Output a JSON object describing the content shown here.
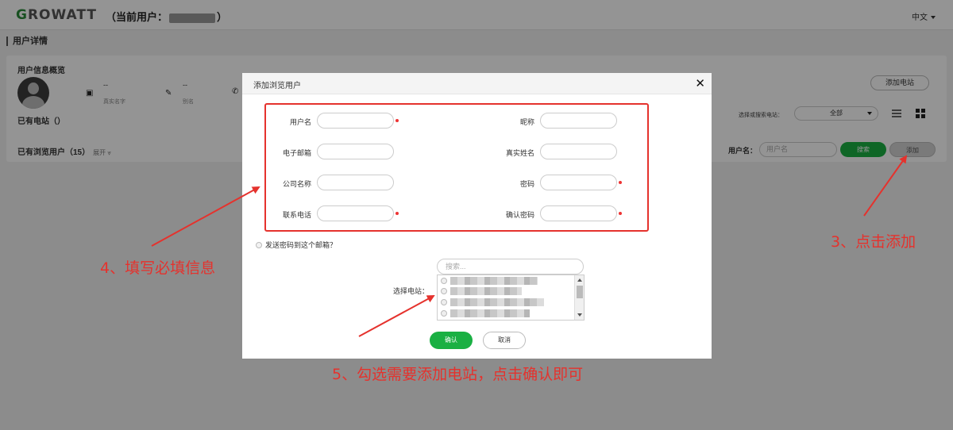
{
  "header": {
    "logo": "GROWATT",
    "current_user_prefix": "（当前用户：",
    "current_user_suffix": "）",
    "language": "中文"
  },
  "page": {
    "section_title": "用户详情",
    "overview_title": "用户信息概览",
    "realname_value": "--",
    "realname_label": "真实名字",
    "alias_value": "--",
    "alias_label": "别名",
    "owned_stations": "已有电站（）",
    "browse_users": "已有浏览用户（15）",
    "expand": "展开",
    "add_station_button": "添加电站",
    "station_select_label": "选择或搜索电站：",
    "station_select_value": "全部",
    "username_label": "用户名：",
    "username_placeholder": "用户名",
    "search_button": "搜索",
    "add_button": "添加"
  },
  "modal": {
    "title": "添加浏览用户",
    "close": "✕",
    "fields": {
      "username": "用户名",
      "nickname": "昵称",
      "email": "电子邮箱",
      "realname": "真实姓名",
      "company": "公司名称",
      "password": "密码",
      "phone": "联系电话",
      "confirm_password": "确认密码"
    },
    "send_password_email": "发送密码到这个邮箱？",
    "select_station_label": "选择电站：",
    "station_search_placeholder": "搜索...",
    "confirm_button": "确认",
    "cancel_button": "取消"
  },
  "annotations": {
    "step3": "3、点击添加",
    "step4": "4、填写必填信息",
    "step5": "5、勾选需要添加电站，点击确认即可"
  },
  "colors": {
    "brand_green": "#1ab043",
    "annotation_red": "#e5322d",
    "required_dot": "#e33333"
  }
}
